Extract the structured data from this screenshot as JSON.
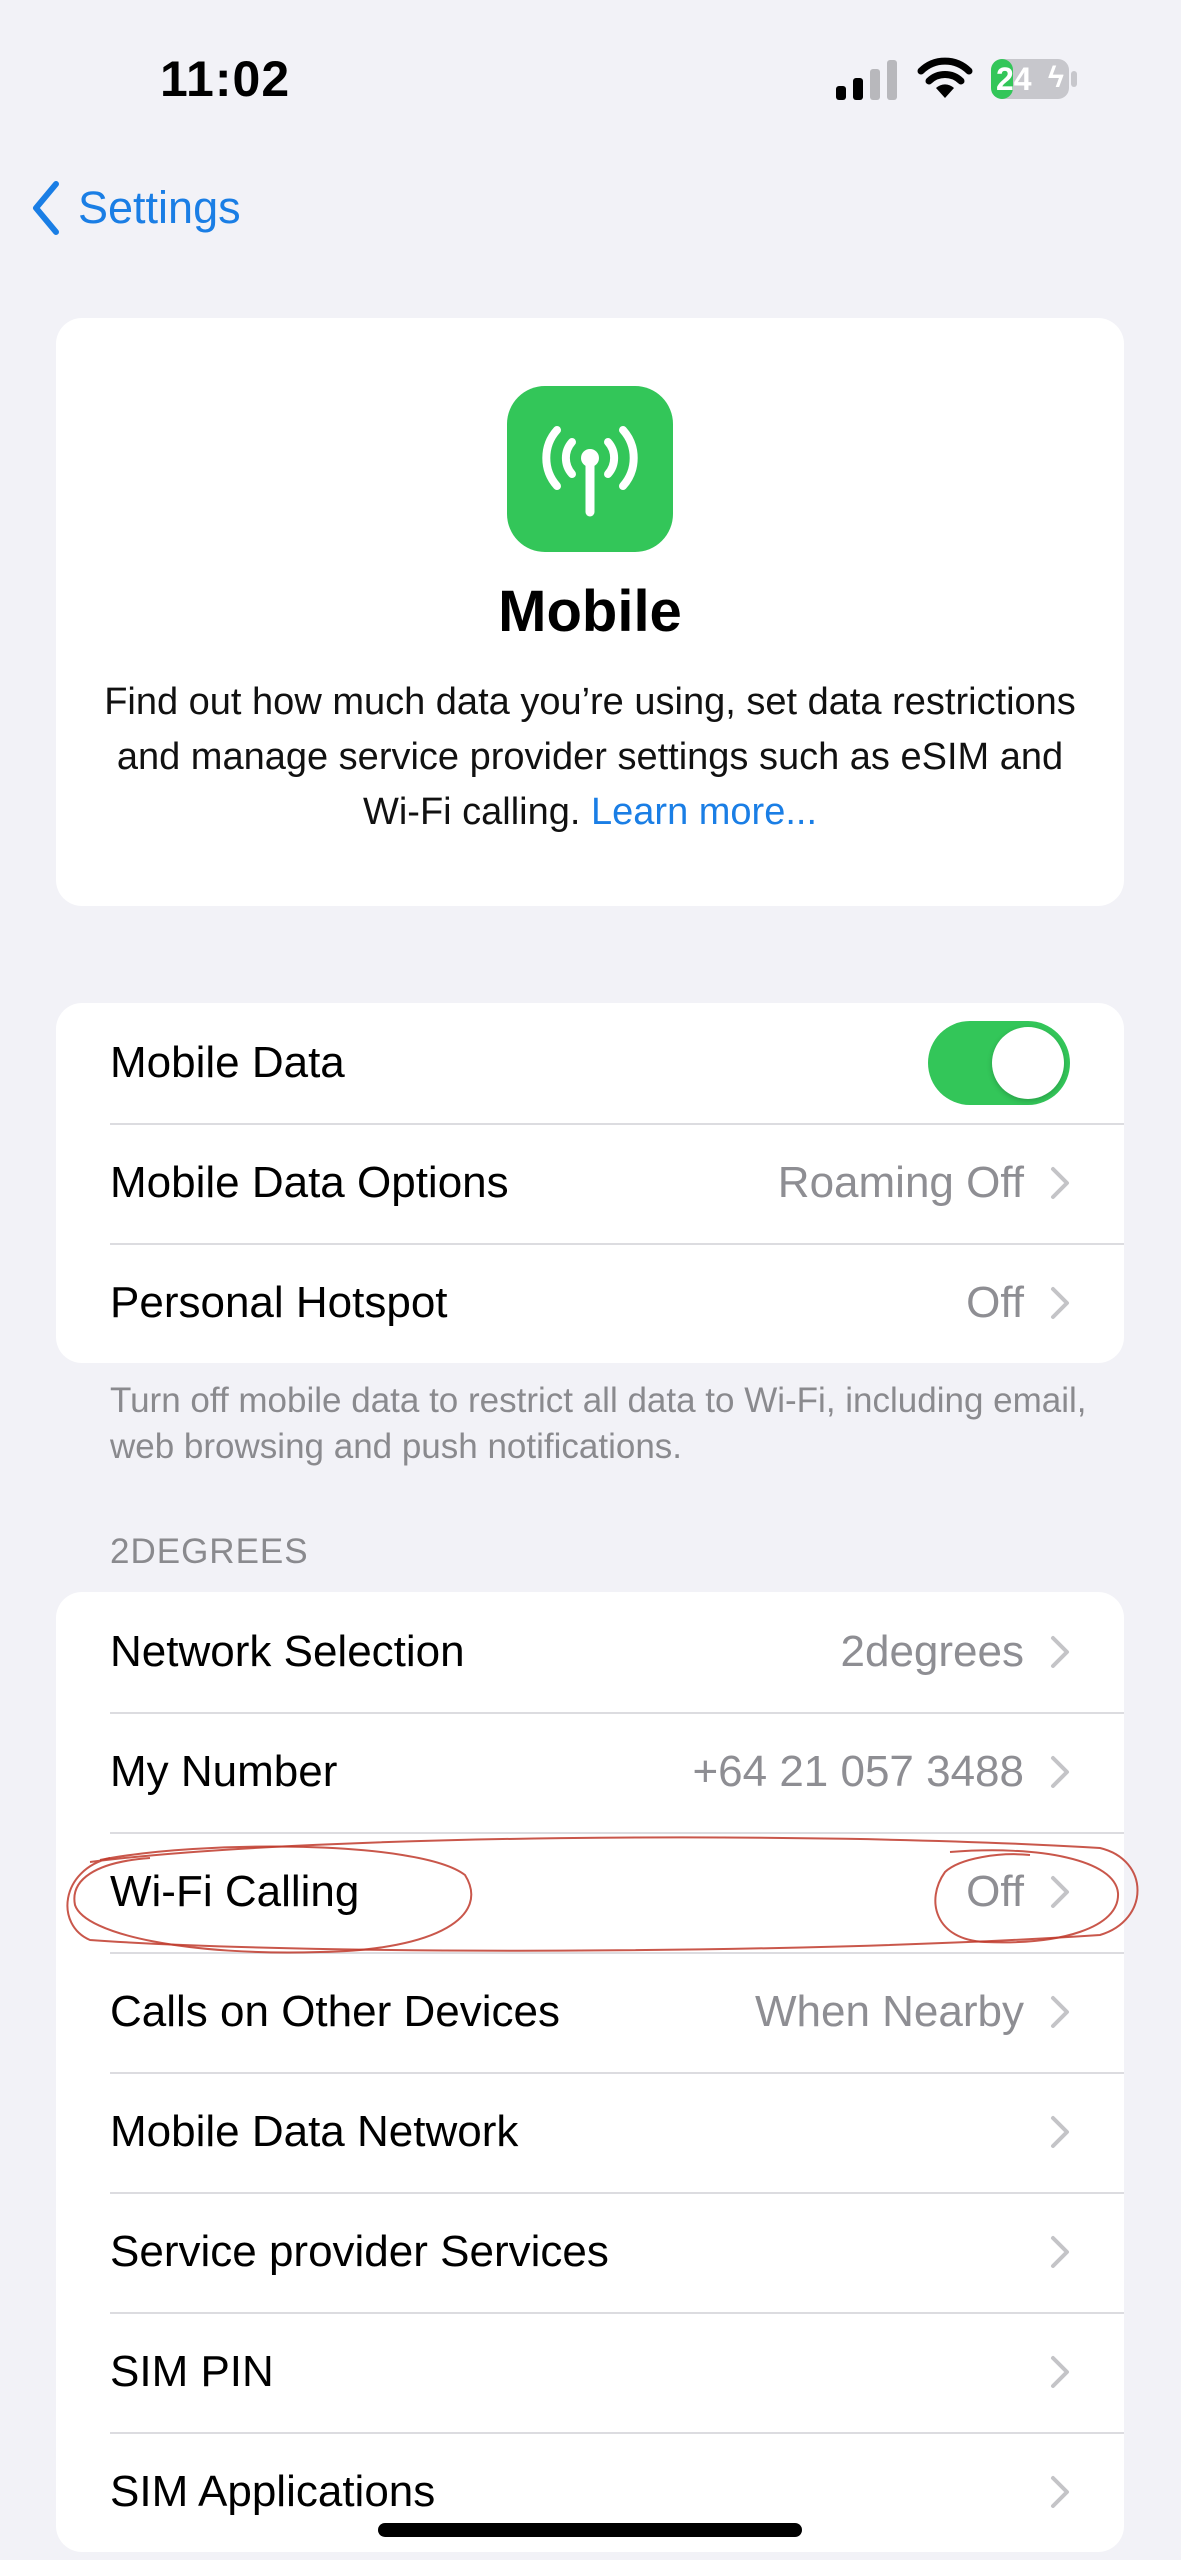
{
  "status_bar": {
    "time": "11:02",
    "battery": "24"
  },
  "nav": {
    "back_label": "Settings"
  },
  "hero": {
    "icon": "antenna-icon",
    "title": "Mobile",
    "description": "Find out how much data you’re using, set data restrictions and manage service provider settings such as eSIM and Wi-Fi calling.",
    "learn_more": "Learn more..."
  },
  "data_group": {
    "rows": [
      {
        "label": "Mobile Data",
        "toggle_on": true
      },
      {
        "label": "Mobile Data Options",
        "value": "Roaming Off"
      },
      {
        "label": "Personal Hotspot",
        "value": "Off"
      }
    ],
    "footer": "Turn off mobile data to restrict all data to Wi-Fi, including email, web browsing and push notifications."
  },
  "carrier_group": {
    "header": "2DEGREES",
    "rows": [
      {
        "label": "Network Selection",
        "value": "2degrees"
      },
      {
        "label": "My Number",
        "value": "+64 21 057 3488"
      },
      {
        "label": "Wi-Fi Calling",
        "value": "Off"
      },
      {
        "label": "Calls on Other Devices",
        "value": "When Nearby"
      },
      {
        "label": "Mobile Data Network",
        "value": ""
      },
      {
        "label": "Service provider Services",
        "value": ""
      },
      {
        "label": "SIM PIN",
        "value": ""
      },
      {
        "label": "SIM Applications",
        "value": ""
      }
    ]
  },
  "colors": {
    "accent": "#1a7ee5",
    "green": "#33c659",
    "annotation": "#c0392b"
  }
}
